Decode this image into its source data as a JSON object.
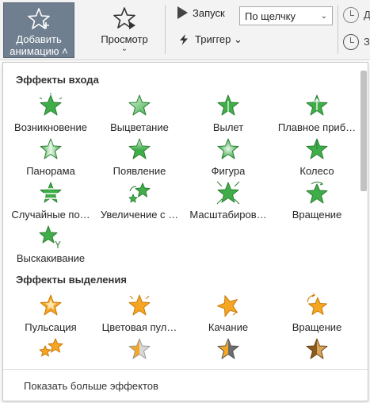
{
  "ribbon": {
    "add_animation_label_1": "Добавить",
    "add_animation_label_2": "анимацию ˄",
    "preview_label": "Просмотр",
    "preview_chevron": "⌄",
    "start_label": "Запуск",
    "start_value": "По щелчку",
    "trigger_label": "Триггер ⌄",
    "cut_label_1": "Д",
    "cut_label_2": "З"
  },
  "colors": {
    "entrance_green": "#3fae49",
    "emphasis_orange": "#f5a623",
    "ribbon_selected": "#6f7f8f"
  },
  "entrance": {
    "title": "Эффекты входа",
    "items": [
      {
        "label": "Возникновение",
        "icon": "star-appear-icon"
      },
      {
        "label": "Выцветание",
        "icon": "star-fade-icon"
      },
      {
        "label": "Вылет",
        "icon": "star-fly-in-icon"
      },
      {
        "label": "Плавное приб…",
        "icon": "star-float-in-icon"
      },
      {
        "label": "Панорама",
        "icon": "star-split-icon"
      },
      {
        "label": "Появление",
        "icon": "star-wipe-icon"
      },
      {
        "label": "Фигура",
        "icon": "star-shape-icon"
      },
      {
        "label": "Колесо",
        "icon": "star-wheel-icon"
      },
      {
        "label": "Случайные по…",
        "icon": "star-random-bars-icon"
      },
      {
        "label": "Увеличение с …",
        "icon": "star-grow-turn-icon"
      },
      {
        "label": "Масштабиров…",
        "icon": "star-zoom-icon"
      },
      {
        "label": "Вращение",
        "icon": "star-swivel-icon"
      },
      {
        "label": "Выскакивание",
        "icon": "star-bounce-icon"
      }
    ]
  },
  "emphasis": {
    "title": "Эффекты выделения",
    "items": [
      {
        "label": "Пульсация",
        "icon": "star-pulse-icon"
      },
      {
        "label": "Цветовая пул…",
        "icon": "star-color-pulse-icon"
      },
      {
        "label": "Качание",
        "icon": "star-teeter-icon"
      },
      {
        "label": "Вращение",
        "icon": "star-spin-icon"
      },
      {
        "label": "",
        "icon": "star-grow-shrink-icon"
      },
      {
        "label": "",
        "icon": "star-desaturate-icon"
      },
      {
        "label": "",
        "icon": "star-darken-icon"
      },
      {
        "label": "",
        "icon": "star-lighten-icon"
      }
    ]
  },
  "more_effects": "Показать больше эффектов"
}
